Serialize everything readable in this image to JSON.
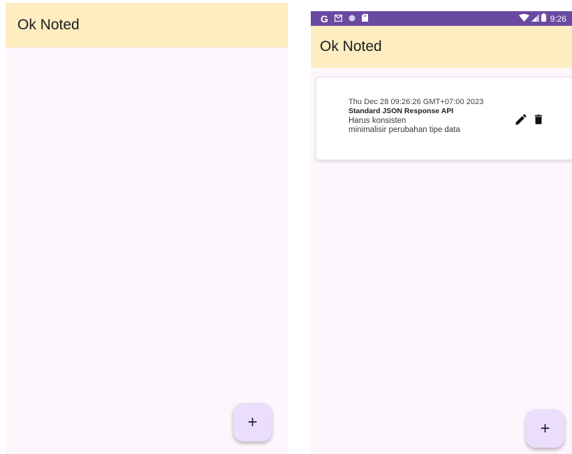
{
  "left_screen": {
    "app_bar": {
      "title": "Ok Noted"
    },
    "fab": {
      "label": "+"
    }
  },
  "right_screen": {
    "status_bar": {
      "left_icons": [
        "google-icon",
        "gmail-icon",
        "circle-notification-icon",
        "sd-card-icon"
      ],
      "google_glyph": "G",
      "right_icons": [
        "wifi-icon",
        "cellular-signal-icon",
        "battery-icon"
      ],
      "time": "9:26"
    },
    "app_bar": {
      "title": "Ok Noted"
    },
    "notes": [
      {
        "date": "Thu Dec 28 09:26:26 GMT+07:00 2023",
        "title": "Standard JSON Response API",
        "body_lines": [
          "Harus konsisten",
          "minimalisir perubahan tipe data"
        ],
        "actions": [
          "edit-icon",
          "delete-icon"
        ]
      }
    ],
    "fab": {
      "label": "+"
    }
  },
  "colors": {
    "app_bar_bg": "#fdedc1",
    "screen_bg": "#fdf7fd",
    "status_bar_bg": "#6a4aa0",
    "fab_bg": "#ebdefc"
  }
}
